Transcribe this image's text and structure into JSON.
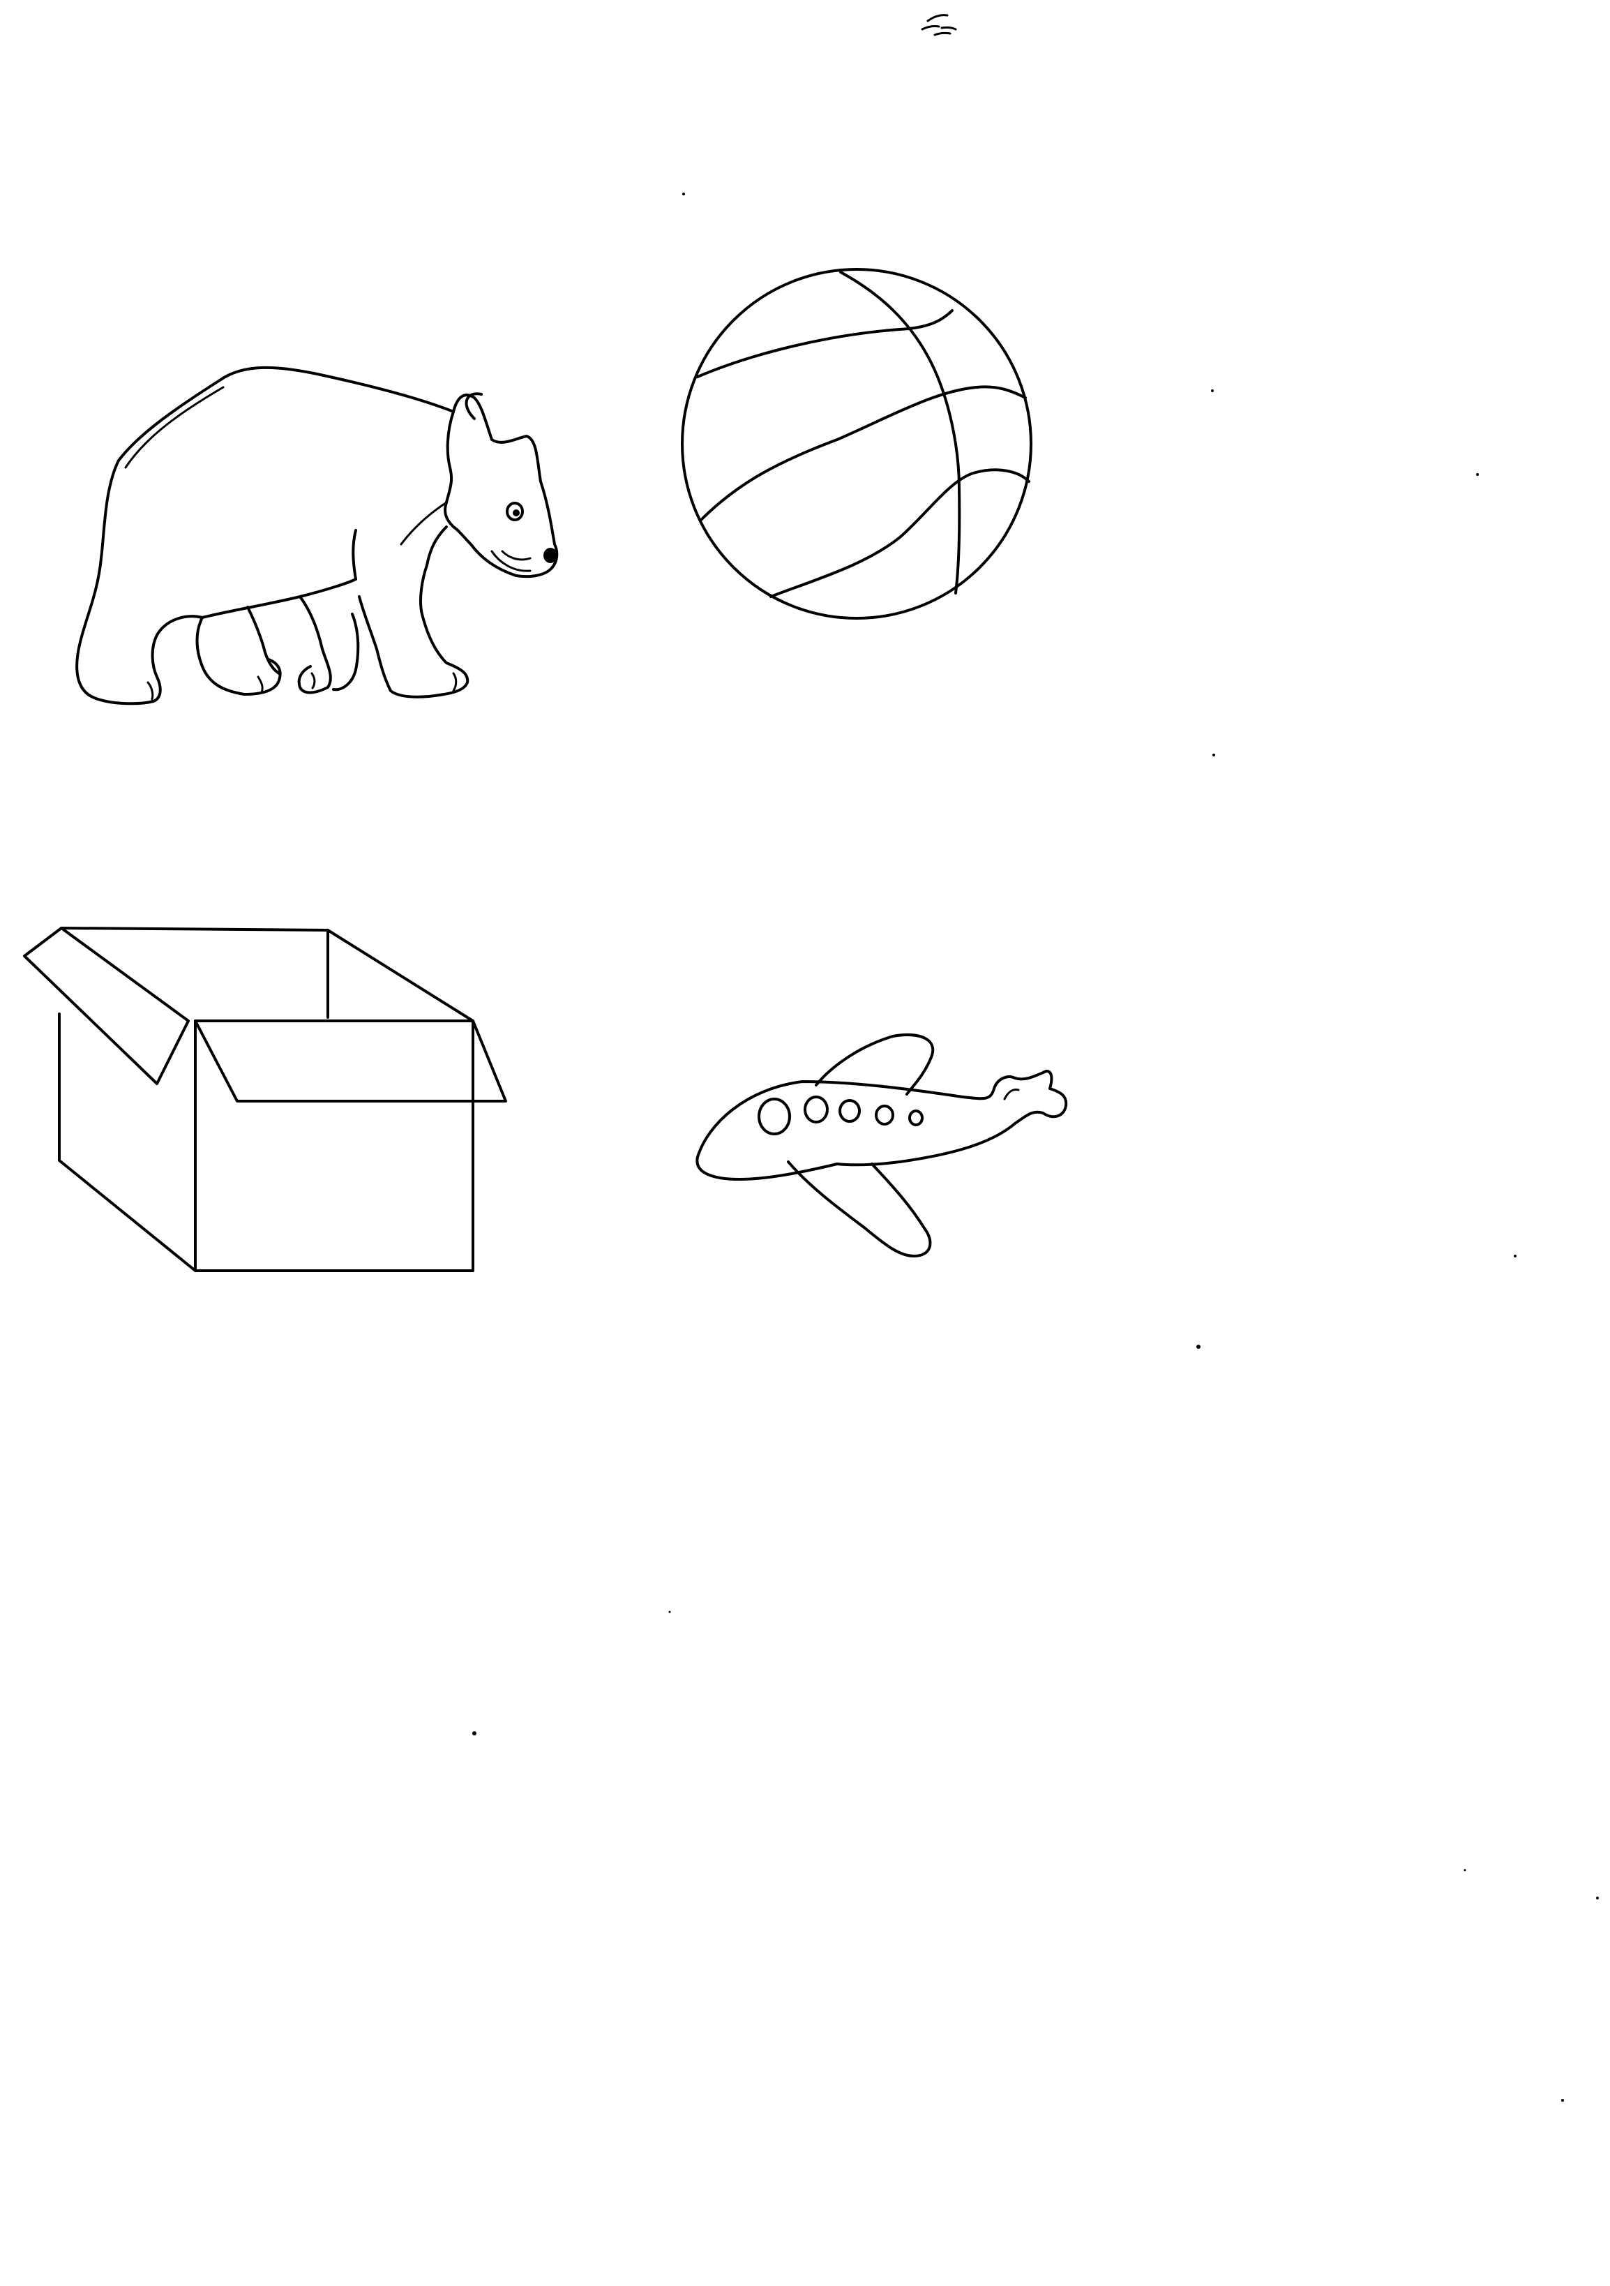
{
  "page": {
    "background_color": "#ffffff",
    "ink_color": "#000000"
  },
  "illustrations": [
    {
      "name": "bear",
      "icon": "bear-icon"
    },
    {
      "name": "ball",
      "icon": "ball-icon"
    },
    {
      "name": "box",
      "icon": "box-icon"
    },
    {
      "name": "airplane",
      "icon": "airplane-icon"
    }
  ]
}
